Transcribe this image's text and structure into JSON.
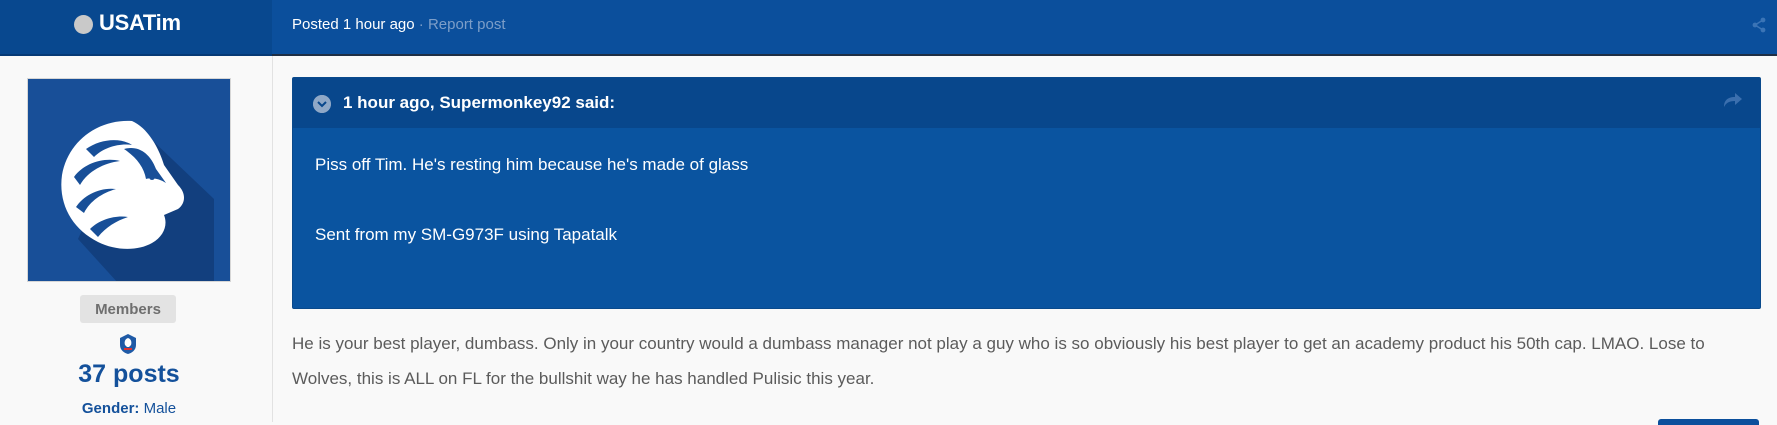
{
  "author": {
    "username": "USATim",
    "group": "Members",
    "post_count": "37 posts",
    "gender_label": "Gender:",
    "gender_value": "Male"
  },
  "post": {
    "posted_label": "Posted",
    "posted_time": "1 hour ago",
    "separator": "·",
    "report_label": "Report post",
    "quote": {
      "citation": "1 hour ago, Supermonkey92 said:",
      "line1": "Piss off Tim. He's resting him because he's made of glass",
      "line2": "Sent from my SM-G973F using Tapatalk"
    },
    "body": "He is your best player, dumbass. Only in your country would a dumbass manager not play a guy who is so obviously his best player to get an academy product his 50th cap. LMAO. Lose to Wolves, this is ALL on FL for the bullshit way he has handled Pulisic this year."
  },
  "icons": {
    "online_status": "online-status-dot",
    "share": "share-icon",
    "quote_toggle": "chevron-down-icon",
    "quote_share": "forward-arrow-icon",
    "avatar": "lion-avatar",
    "club": "club-crest-icon"
  },
  "colors": {
    "header_blue": "#0b4f9c",
    "quote_blue": "#0a54a0",
    "link_blue": "#14519b",
    "body_text": "#5b5b5b"
  }
}
